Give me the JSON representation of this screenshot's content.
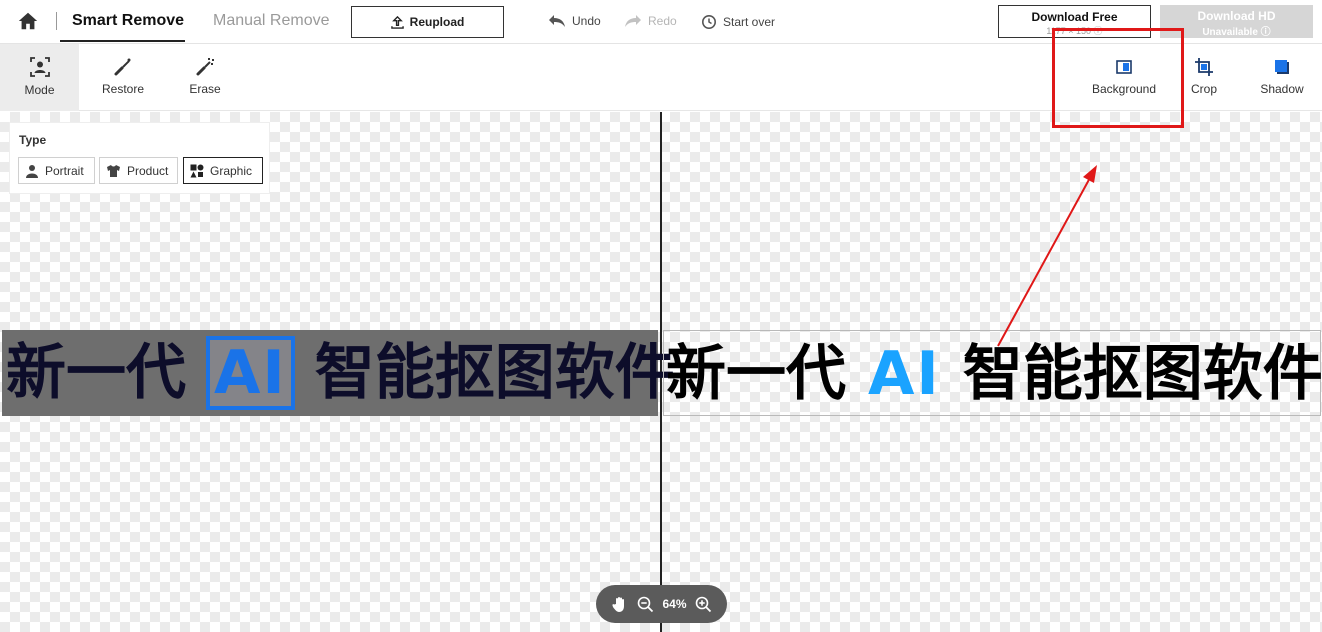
{
  "topbar": {
    "tab_smart": "Smart Remove",
    "tab_manual": "Manual Remove",
    "reupload": "Reupload",
    "undo": "Undo",
    "redo": "Redo",
    "start_over": "Start over",
    "download_free": "Download Free",
    "download_free_size": "1177 × 150 ⓘ",
    "download_hd": "Download HD",
    "download_hd_status": "Unavailable ⓘ"
  },
  "toolbar": {
    "mode": "Mode",
    "restore": "Restore",
    "erase": "Erase",
    "background": "Background",
    "crop": "Crop",
    "shadow": "Shadow"
  },
  "type_panel": {
    "title": "Type",
    "options": [
      "Portrait",
      "Product",
      "Graphic"
    ],
    "selected": "Graphic"
  },
  "banner": {
    "prefix": "新一代",
    "ai": "AI",
    "suffix": "智能抠图软件"
  },
  "zoom": {
    "level": "64%"
  },
  "colors": {
    "annotation": "#e01818",
    "ai_text": "#1aa3ff",
    "accent_dark": "#222222"
  }
}
